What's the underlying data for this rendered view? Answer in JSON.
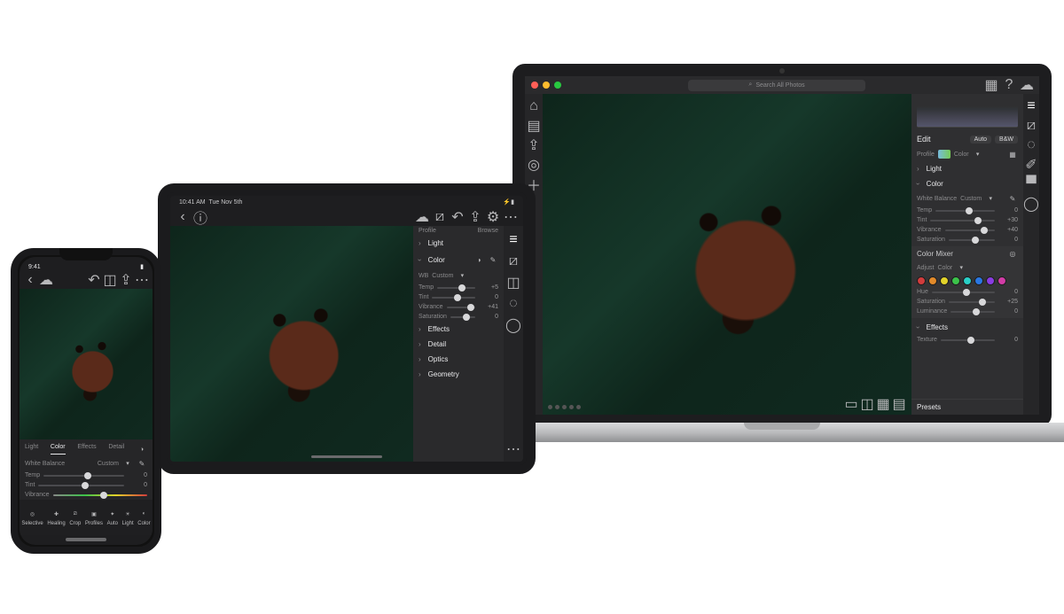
{
  "laptop": {
    "search_placeholder": "Search All Photos",
    "edit": {
      "title": "Edit",
      "auto": "Auto",
      "bw": "B&W",
      "profile_label": "Profile",
      "profile_value": "Color",
      "sections": {
        "light": "Light",
        "color": "Color",
        "effects": "Effects",
        "presets": "Presets"
      },
      "white_balance_label": "White Balance",
      "white_balance_value": "Custom",
      "sliders": {
        "temp": {
          "label": "Temp",
          "value": "0",
          "pos": 50
        },
        "tint": {
          "label": "Tint",
          "value": "+30",
          "pos": 68
        },
        "vibrance": {
          "label": "Vibrance",
          "value": "+40",
          "pos": 72
        },
        "saturation": {
          "label": "Saturation",
          "value": "0",
          "pos": 50
        }
      },
      "mixer": {
        "title": "Color Mixer",
        "adjust_label": "Adjust",
        "adjust_value": "Color",
        "swatches": [
          "#d23c3c",
          "#e28a2a",
          "#e2d32a",
          "#3cc24a",
          "#2ad0c7",
          "#2a77e2",
          "#8a3ce2",
          "#d23ca6"
        ],
        "hue": {
          "label": "Hue",
          "value": "0",
          "pos": 50
        },
        "saturation": {
          "label": "Saturation",
          "value": "+25",
          "pos": 66
        },
        "luminance": {
          "label": "Luminance",
          "value": "0",
          "pos": 50
        }
      },
      "effects_sliders": {
        "texture": {
          "label": "Texture",
          "value": "0",
          "pos": 50
        }
      }
    }
  },
  "tablet": {
    "status_time": "10:41 AM",
    "status_date": "Tue Nov 5th",
    "edit": {
      "profile_label": "Profile",
      "browse": "Browse",
      "sections": {
        "light": "Light",
        "color": "Color",
        "effects": "Effects",
        "detail": "Detail",
        "optics": "Optics",
        "geometry": "Geometry"
      },
      "wb_label": "WB",
      "wb_value": "Custom",
      "sliders": {
        "temp": {
          "label": "Temp",
          "value": "+5",
          "pos": 55
        },
        "tint": {
          "label": "Tint",
          "value": "0",
          "pos": 50
        },
        "vibrance": {
          "label": "Vibrance",
          "value": "+41",
          "pos": 73
        },
        "saturation": {
          "label": "Saturation",
          "value": "0",
          "pos": 50
        }
      }
    }
  },
  "phone": {
    "status_time": "9:41",
    "edit_tabs": {
      "light": "Light",
      "color": "Color",
      "effects": "Effects",
      "detail": "Detail"
    },
    "wb_label": "White Balance",
    "wb_value": "Custom",
    "sliders": {
      "temp": {
        "label": "Temp",
        "value": "0",
        "pos": 50
      },
      "tint": {
        "label": "Tint",
        "value": "0",
        "pos": 50
      },
      "vibrance": {
        "label": "Vibrance",
        "value": "",
        "pos": 50
      }
    },
    "tools": {
      "selective": "Selective",
      "healing": "Healing",
      "crop": "Crop",
      "profiles": "Profiles",
      "auto": "Auto",
      "light": "Light",
      "color": "Color"
    }
  }
}
